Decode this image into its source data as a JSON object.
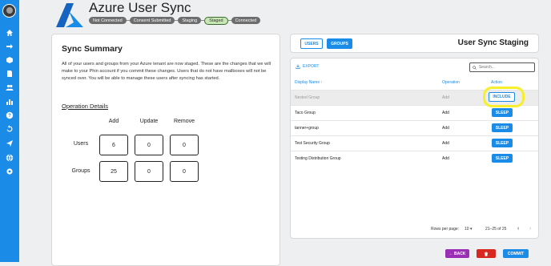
{
  "app": {
    "title": "Azure User Sync",
    "brand_color": "#1a8ce8"
  },
  "sidebar": {
    "icons": [
      "home-icon",
      "transfer-icon",
      "box-icon",
      "document-icon",
      "users-icon",
      "bar-chart-icon",
      "help-icon",
      "sync-icon",
      "send-icon",
      "globe-icon",
      "settings-icon"
    ]
  },
  "stepper": {
    "steps": [
      "Not Connected",
      "Consent Submitted",
      "Staging",
      "Staged",
      "Connected"
    ],
    "current": "Staged"
  },
  "summary": {
    "title": "Sync Summary",
    "description": "All of your users and groups from your Azure tenant are now staged. These are the changes that we will make to your Phin account if you commit these changes. Users that do not have mailboxes will not be synced over. You will be able to manage these users after syncing has started.",
    "operation_details_label": "Operation Details",
    "columns": [
      "Add",
      "Update",
      "Remove"
    ],
    "rows": [
      {
        "label": "Users",
        "values": [
          "6",
          "0",
          "0"
        ]
      },
      {
        "label": "Groups",
        "values": [
          "25",
          "0",
          "0"
        ]
      }
    ]
  },
  "staging": {
    "tabs": [
      "USERS",
      "GROUPS"
    ],
    "active_tab": "GROUPS",
    "title": "User Sync Staging",
    "export_label": "EXPORT",
    "search_placeholder": "Search...",
    "columns": {
      "name": "Display Name",
      "operation": "Operation",
      "action": "Action"
    },
    "rows": [
      {
        "name": "Nested Group",
        "operation": "Add",
        "action": "INCLUDE"
      },
      {
        "name": "Taco Group",
        "operation": "Add",
        "action": "SLEEP"
      },
      {
        "name": "tanner+group",
        "operation": "Add",
        "action": "SLEEP"
      },
      {
        "name": "Test Security Group",
        "operation": "Add",
        "action": "SLEEP"
      },
      {
        "name": "Testing Distribution Group",
        "operation": "Add",
        "action": "SLEEP"
      }
    ],
    "rows_per_page_label": "Rows per page:",
    "rows_per_page": "10",
    "range": "21–25 of 25"
  },
  "actions": {
    "back": "BACK",
    "commit": "COMMIT"
  }
}
